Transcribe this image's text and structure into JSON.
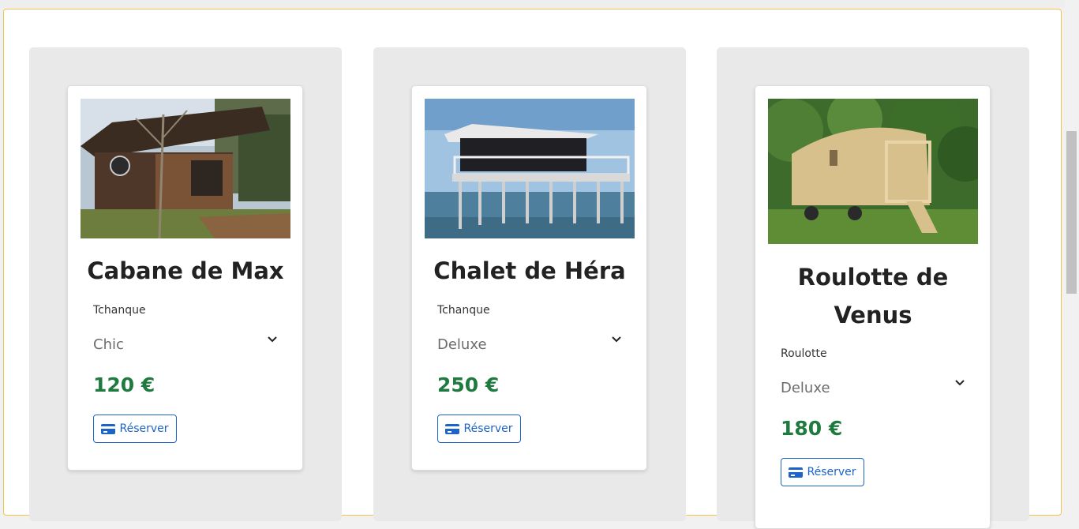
{
  "listings": [
    {
      "title": "Cabane de Max",
      "type": "Tchanque",
      "option": "Chic",
      "price": "120 €",
      "button": "Réserver",
      "image": "wooden-cabin-photo"
    },
    {
      "title": "Chalet de Héra",
      "type": "Tchanque",
      "option": "Deluxe",
      "price": "250 €",
      "button": "Réserver",
      "image": "stilt-house-on-water-photo"
    },
    {
      "title": "Roulotte de Venus",
      "type": "Roulotte",
      "option": "Deluxe",
      "price": "180 €",
      "button": "Réserver",
      "image": "wooden-caravan-photo"
    }
  ],
  "colors": {
    "price": "#1f7a3f",
    "button": "#1d64c8",
    "frame_border": "#f2c14e",
    "column_bg": "#e9e9e9"
  }
}
